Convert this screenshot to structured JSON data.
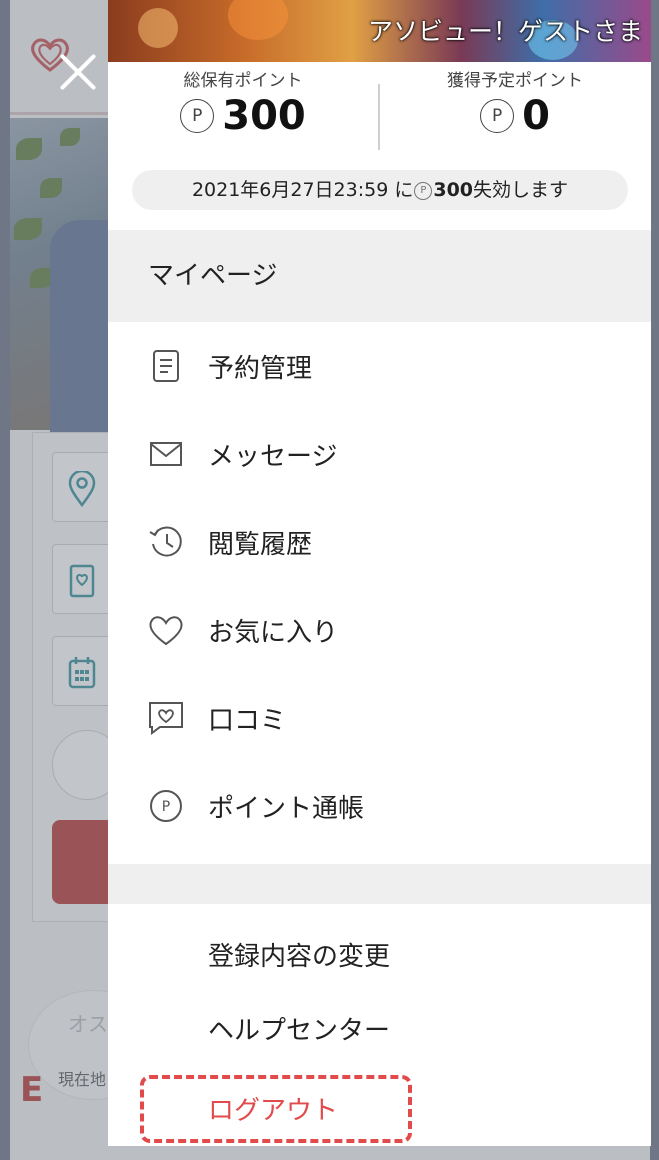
{
  "banner": {
    "greeting": "アソビュー！ゲストさま"
  },
  "points": {
    "total_label": "総保有ポイント",
    "total_value": "300",
    "pending_label": "獲得予定ポイント",
    "pending_value": "0",
    "point_symbol": "P"
  },
  "expiry": {
    "date_text": "2021年6月27日23:59 に",
    "amount": "300",
    "suffix": "失効します"
  },
  "mypage_label": "マイページ",
  "menu": [
    {
      "label": "予約管理",
      "icon": "document-icon"
    },
    {
      "label": "メッセージ",
      "icon": "envelope-icon"
    },
    {
      "label": "閲覧履歴",
      "icon": "history-icon"
    },
    {
      "label": "お気に入り",
      "icon": "heart-icon"
    },
    {
      "label": "口コミ",
      "icon": "review-icon"
    },
    {
      "label": "ポイント通帳",
      "icon": "point-icon"
    }
  ],
  "sub_menu": {
    "edit_profile": "登録内容の変更",
    "help_center": "ヘルプセンター",
    "logout": "ログアウト"
  },
  "background": {
    "oval_text": "現在地",
    "oval_top": "オス",
    "red_glyph": "E"
  },
  "colors": {
    "accent_red": "#e24b4b",
    "brand_red": "#b6312e",
    "gray_band": "#efefef"
  }
}
